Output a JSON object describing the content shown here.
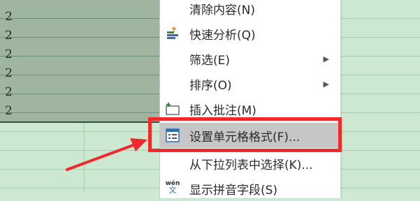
{
  "cells": [
    "2",
    "2",
    "2",
    "2",
    "2",
    "2"
  ],
  "menu": {
    "items": [
      {
        "label": "清除内容(N)",
        "icon": "none"
      },
      {
        "label": "快速分析(Q)",
        "icon": "quick-analysis-icon"
      },
      {
        "label": "筛选(E)",
        "icon": "none",
        "submenu": true
      },
      {
        "label": "排序(O)",
        "icon": "none",
        "submenu": true
      },
      {
        "label": "插入批注(M)",
        "icon": "insert-comment-icon"
      },
      {
        "label": "设置单元格格式(F)...",
        "icon": "format-cells-icon",
        "highlighted": true
      },
      {
        "label": "从下拉列表中选择(K)...",
        "icon": "none"
      },
      {
        "label": "显示拼音字段(S)",
        "icon": "phonetic-icon"
      }
    ],
    "phonetic_icon_text": "wén",
    "phonetic_icon_char": "文",
    "submenu_arrow": "▶"
  },
  "annotation": {
    "color": "#f0292d"
  }
}
